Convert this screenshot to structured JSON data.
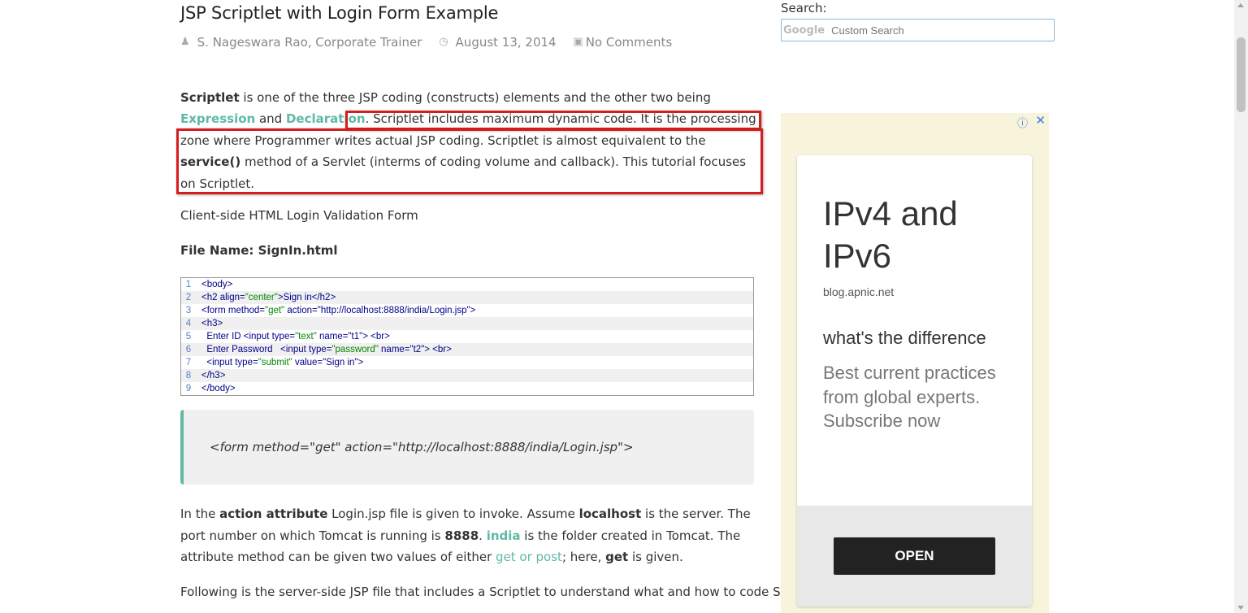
{
  "article": {
    "title": "JSP Scriptlet with Login Form Example",
    "author": "S. Nageswara Rao, Corporate Trainer",
    "date": "August 13, 2014",
    "comments": "No Comments",
    "intro": {
      "t1": "Scriptlet",
      "t2": " is one of the three JSP coding (constructs) elements and the other two being ",
      "link_expression": "Expression",
      "t3": " and ",
      "link_declaration": "Declaration",
      "t4": ". Scriptlet includes maximum dynamic code. It is the processing zone where Programmer writes actual JSP coding. Scriptlet is almost equivalent to the ",
      "t5": "service()",
      "t6": " method of a Servlet (interms of coding volume and callback). This tutorial focuses on Scriptlet."
    },
    "subheading": "Client-side HTML Login Validation Form",
    "file_name": "File Name: SignIn.html",
    "code_lines": [
      {
        "n": "1",
        "a": "<body>",
        "s": "",
        "b": ""
      },
      {
        "n": "2",
        "a": "<h2 align=",
        "s": "\"center\"",
        "b": ">Sign in</h2>"
      },
      {
        "n": "3",
        "a": "<form method=",
        "s": "\"get\"",
        "b": " action=\"http://localhost:8888/india/Login.jsp\">"
      },
      {
        "n": "4",
        "a": "<h3>",
        "s": "",
        "b": ""
      },
      {
        "n": "5",
        "a": "  Enter ID <input type=",
        "s": "\"text\"",
        "b": " name=\"t1\"> <br>"
      },
      {
        "n": "6",
        "a": "  Enter Password   <input type=",
        "s": "\"password\"",
        "b": " name=\"t2\"> <br>"
      },
      {
        "n": "7",
        "a": "  <input type=",
        "s": "\"submit\"",
        "b": " value=\"Sign in\">"
      },
      {
        "n": "8",
        "a": "</h3>",
        "s": "",
        "b": ""
      },
      {
        "n": "9",
        "a": "</body>",
        "s": "",
        "b": ""
      }
    ],
    "quote": "<form method=\"get\" action=\"http://localhost:8888/india/Login.jsp\">",
    "para_action": {
      "t1": "In the ",
      "b1": "action attribute",
      "t2": " Login.jsp file is given to invoke. Assume ",
      "b2": "localhost",
      "t3": " is the server. The port number on which Tomcat is running is ",
      "b3": "8888",
      "t4": ". ",
      "link_india": "india",
      "t5": " is the folder created in Tomcat. The attribute method can be given two values of either ",
      "link_getpost": "get or post",
      "t6": "; here, ",
      "b4": "get",
      "t7": " is given."
    },
    "para_following": "Following is the server-side JSP file that includes a Scriptlet to understand what and how to code Scriptlet."
  },
  "sidebar": {
    "search_label": "Search:",
    "search_brand": "Google",
    "search_placeholder": "Custom Search"
  },
  "ad": {
    "headline": "IPv4 and IPv6",
    "domain": "blog.apnic.net",
    "subhead": "what's the difference",
    "body": "Best current practices from global experts. Subscribe now",
    "button": "OPEN",
    "info_icon": "ⓘ",
    "close_icon": "✕"
  },
  "colors": {
    "accent": "#5fb9a5",
    "highlight_box": "#d41e1e",
    "ad_background": "#f8f4dc"
  }
}
